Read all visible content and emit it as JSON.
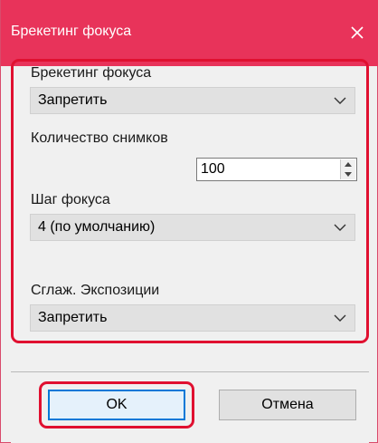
{
  "window": {
    "title": "Брекетинг фокуса",
    "close_glyph": "✕"
  },
  "fields": {
    "bracketing": {
      "label": "Брекетинг фокуса",
      "value": "Запретить"
    },
    "shots": {
      "label": "Количество снимков",
      "value": "100"
    },
    "step": {
      "label": "Шаг фокуса",
      "value": "4 (по умолчанию)"
    },
    "smooth": {
      "label": "Сглаж. Экспозиции",
      "value": "Запретить"
    }
  },
  "buttons": {
    "ok": "OK",
    "cancel": "Отмена"
  },
  "colors": {
    "titlebar": "#e8335a",
    "highlight": "#e01030",
    "combo_bg": "#e1e1e1",
    "default_button_border": "#0078d7"
  }
}
